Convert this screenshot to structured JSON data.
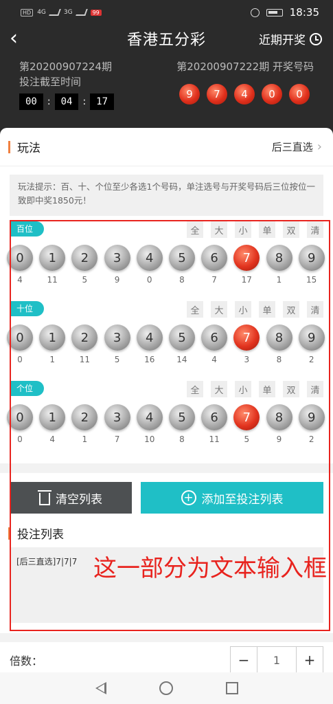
{
  "status": {
    "time": "18:35",
    "net1": "4G",
    "net2": "3G",
    "hd": "HD",
    "badge": "99"
  },
  "header": {
    "title": "香港五分彩",
    "recent_label": "近期开奖"
  },
  "issue": {
    "current": "第20200907224期",
    "deadline_label": "投注截至时间",
    "countdown": [
      "00",
      "04",
      "17"
    ]
  },
  "previous": {
    "label": "第20200907222期 开奖号码",
    "numbers": [
      "9",
      "7",
      "4",
      "0",
      "0"
    ]
  },
  "play": {
    "label": "玩法",
    "method": "后三直选"
  },
  "hint": "玩法提示：百、十、个位至少各选1个号码，单注选号与开奖号码后三位按位一致即中奖1850元！",
  "filters": [
    "全",
    "大",
    "小",
    "单",
    "双",
    "清"
  ],
  "digits": [
    "0",
    "1",
    "2",
    "3",
    "4",
    "5",
    "6",
    "7",
    "8",
    "9"
  ],
  "positions": [
    {
      "name": "百位",
      "selected": "7",
      "misses": [
        "4",
        "11",
        "5",
        "9",
        "0",
        "8",
        "7",
        "17",
        "1",
        "15"
      ]
    },
    {
      "name": "十位",
      "selected": "7",
      "misses": [
        "0",
        "1",
        "11",
        "5",
        "16",
        "14",
        "4",
        "3",
        "8",
        "2"
      ]
    },
    {
      "name": "个位",
      "selected": "7",
      "misses": [
        "0",
        "4",
        "1",
        "7",
        "10",
        "8",
        "11",
        "5",
        "9",
        "2"
      ]
    }
  ],
  "buttons": {
    "clear": "清空列表",
    "add": "添加至投注列表"
  },
  "bet_list": {
    "title": "投注列表",
    "entry": "[后三直选]7|7|7"
  },
  "annotation": "这一部分为文本输入框",
  "multiplier": {
    "label": "倍数：",
    "value": "1",
    "minus": "−",
    "plus": "+"
  },
  "colors": {
    "accent": "#1fbfc6",
    "red": "#e8231e",
    "header_bg": "#2b2b2b"
  }
}
